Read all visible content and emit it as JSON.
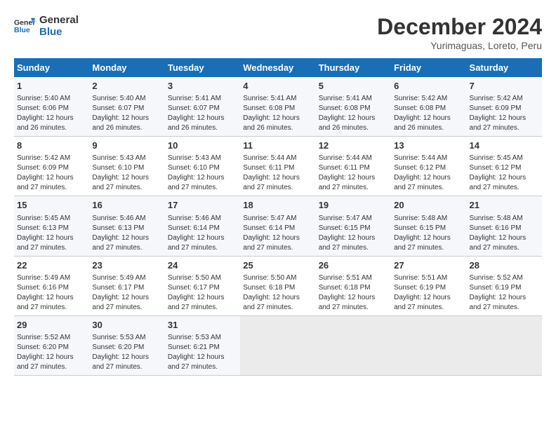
{
  "header": {
    "logo_line1": "General",
    "logo_line2": "Blue",
    "month": "December 2024",
    "location": "Yurimaguas, Loreto, Peru"
  },
  "days_of_week": [
    "Sunday",
    "Monday",
    "Tuesday",
    "Wednesday",
    "Thursday",
    "Friday",
    "Saturday"
  ],
  "weeks": [
    [
      {
        "day": "1",
        "sunrise": "5:40 AM",
        "sunset": "6:06 PM",
        "daylight": "12 hours and 26 minutes."
      },
      {
        "day": "2",
        "sunrise": "5:40 AM",
        "sunset": "6:07 PM",
        "daylight": "12 hours and 26 minutes."
      },
      {
        "day": "3",
        "sunrise": "5:41 AM",
        "sunset": "6:07 PM",
        "daylight": "12 hours and 26 minutes."
      },
      {
        "day": "4",
        "sunrise": "5:41 AM",
        "sunset": "6:08 PM",
        "daylight": "12 hours and 26 minutes."
      },
      {
        "day": "5",
        "sunrise": "5:41 AM",
        "sunset": "6:08 PM",
        "daylight": "12 hours and 26 minutes."
      },
      {
        "day": "6",
        "sunrise": "5:42 AM",
        "sunset": "6:08 PM",
        "daylight": "12 hours and 26 minutes."
      },
      {
        "day": "7",
        "sunrise": "5:42 AM",
        "sunset": "6:09 PM",
        "daylight": "12 hours and 27 minutes."
      }
    ],
    [
      {
        "day": "8",
        "sunrise": "5:42 AM",
        "sunset": "6:09 PM",
        "daylight": "12 hours and 27 minutes."
      },
      {
        "day": "9",
        "sunrise": "5:43 AM",
        "sunset": "6:10 PM",
        "daylight": "12 hours and 27 minutes."
      },
      {
        "day": "10",
        "sunrise": "5:43 AM",
        "sunset": "6:10 PM",
        "daylight": "12 hours and 27 minutes."
      },
      {
        "day": "11",
        "sunrise": "5:44 AM",
        "sunset": "6:11 PM",
        "daylight": "12 hours and 27 minutes."
      },
      {
        "day": "12",
        "sunrise": "5:44 AM",
        "sunset": "6:11 PM",
        "daylight": "12 hours and 27 minutes."
      },
      {
        "day": "13",
        "sunrise": "5:44 AM",
        "sunset": "6:12 PM",
        "daylight": "12 hours and 27 minutes."
      },
      {
        "day": "14",
        "sunrise": "5:45 AM",
        "sunset": "6:12 PM",
        "daylight": "12 hours and 27 minutes."
      }
    ],
    [
      {
        "day": "15",
        "sunrise": "5:45 AM",
        "sunset": "6:13 PM",
        "daylight": "12 hours and 27 minutes."
      },
      {
        "day": "16",
        "sunrise": "5:46 AM",
        "sunset": "6:13 PM",
        "daylight": "12 hours and 27 minutes."
      },
      {
        "day": "17",
        "sunrise": "5:46 AM",
        "sunset": "6:14 PM",
        "daylight": "12 hours and 27 minutes."
      },
      {
        "day": "18",
        "sunrise": "5:47 AM",
        "sunset": "6:14 PM",
        "daylight": "12 hours and 27 minutes."
      },
      {
        "day": "19",
        "sunrise": "5:47 AM",
        "sunset": "6:15 PM",
        "daylight": "12 hours and 27 minutes."
      },
      {
        "day": "20",
        "sunrise": "5:48 AM",
        "sunset": "6:15 PM",
        "daylight": "12 hours and 27 minutes."
      },
      {
        "day": "21",
        "sunrise": "5:48 AM",
        "sunset": "6:16 PM",
        "daylight": "12 hours and 27 minutes."
      }
    ],
    [
      {
        "day": "22",
        "sunrise": "5:49 AM",
        "sunset": "6:16 PM",
        "daylight": "12 hours and 27 minutes."
      },
      {
        "day": "23",
        "sunrise": "5:49 AM",
        "sunset": "6:17 PM",
        "daylight": "12 hours and 27 minutes."
      },
      {
        "day": "24",
        "sunrise": "5:50 AM",
        "sunset": "6:17 PM",
        "daylight": "12 hours and 27 minutes."
      },
      {
        "day": "25",
        "sunrise": "5:50 AM",
        "sunset": "6:18 PM",
        "daylight": "12 hours and 27 minutes."
      },
      {
        "day": "26",
        "sunrise": "5:51 AM",
        "sunset": "6:18 PM",
        "daylight": "12 hours and 27 minutes."
      },
      {
        "day": "27",
        "sunrise": "5:51 AM",
        "sunset": "6:19 PM",
        "daylight": "12 hours and 27 minutes."
      },
      {
        "day": "28",
        "sunrise": "5:52 AM",
        "sunset": "6:19 PM",
        "daylight": "12 hours and 27 minutes."
      }
    ],
    [
      {
        "day": "29",
        "sunrise": "5:52 AM",
        "sunset": "6:20 PM",
        "daylight": "12 hours and 27 minutes."
      },
      {
        "day": "30",
        "sunrise": "5:53 AM",
        "sunset": "6:20 PM",
        "daylight": "12 hours and 27 minutes."
      },
      {
        "day": "31",
        "sunrise": "5:53 AM",
        "sunset": "6:21 PM",
        "daylight": "12 hours and 27 minutes."
      },
      null,
      null,
      null,
      null
    ]
  ],
  "labels": {
    "sunrise": "Sunrise:",
    "sunset": "Sunset:",
    "daylight": "Daylight:"
  }
}
